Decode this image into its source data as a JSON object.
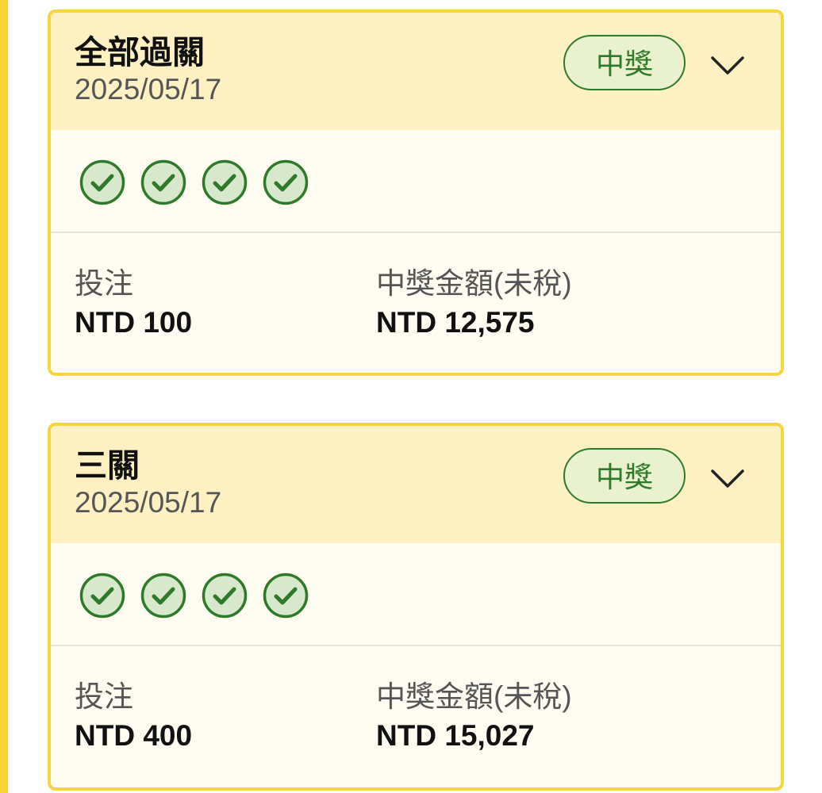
{
  "bets": [
    {
      "title": "全部過關",
      "date": "2025/05/17",
      "status_badge": "中獎",
      "legs": [
        "won",
        "won",
        "won",
        "won"
      ],
      "stake_label": "投注",
      "stake_value": "NTD 100",
      "payout_label": "中獎金額(未稅)",
      "payout_value": "NTD 12,575"
    },
    {
      "title": "三關",
      "date": "2025/05/17",
      "status_badge": "中獎",
      "legs": [
        "won",
        "won",
        "won",
        "won"
      ],
      "stake_label": "投注",
      "stake_value": "NTD 400",
      "payout_label": "中獎金額(未稅)",
      "payout_value": "NTD 15,027"
    }
  ],
  "icons": {
    "leg_won": "check-circle-icon",
    "expand": "chevron-down-icon"
  },
  "colors": {
    "card_border": "#f6d63c",
    "header_bg": "#fdf1c4",
    "body_bg": "#fffcf2",
    "win_green": "#2f7a2a",
    "badge_bg": "#eaf1cf",
    "check_fill": "#d7e8cc"
  }
}
